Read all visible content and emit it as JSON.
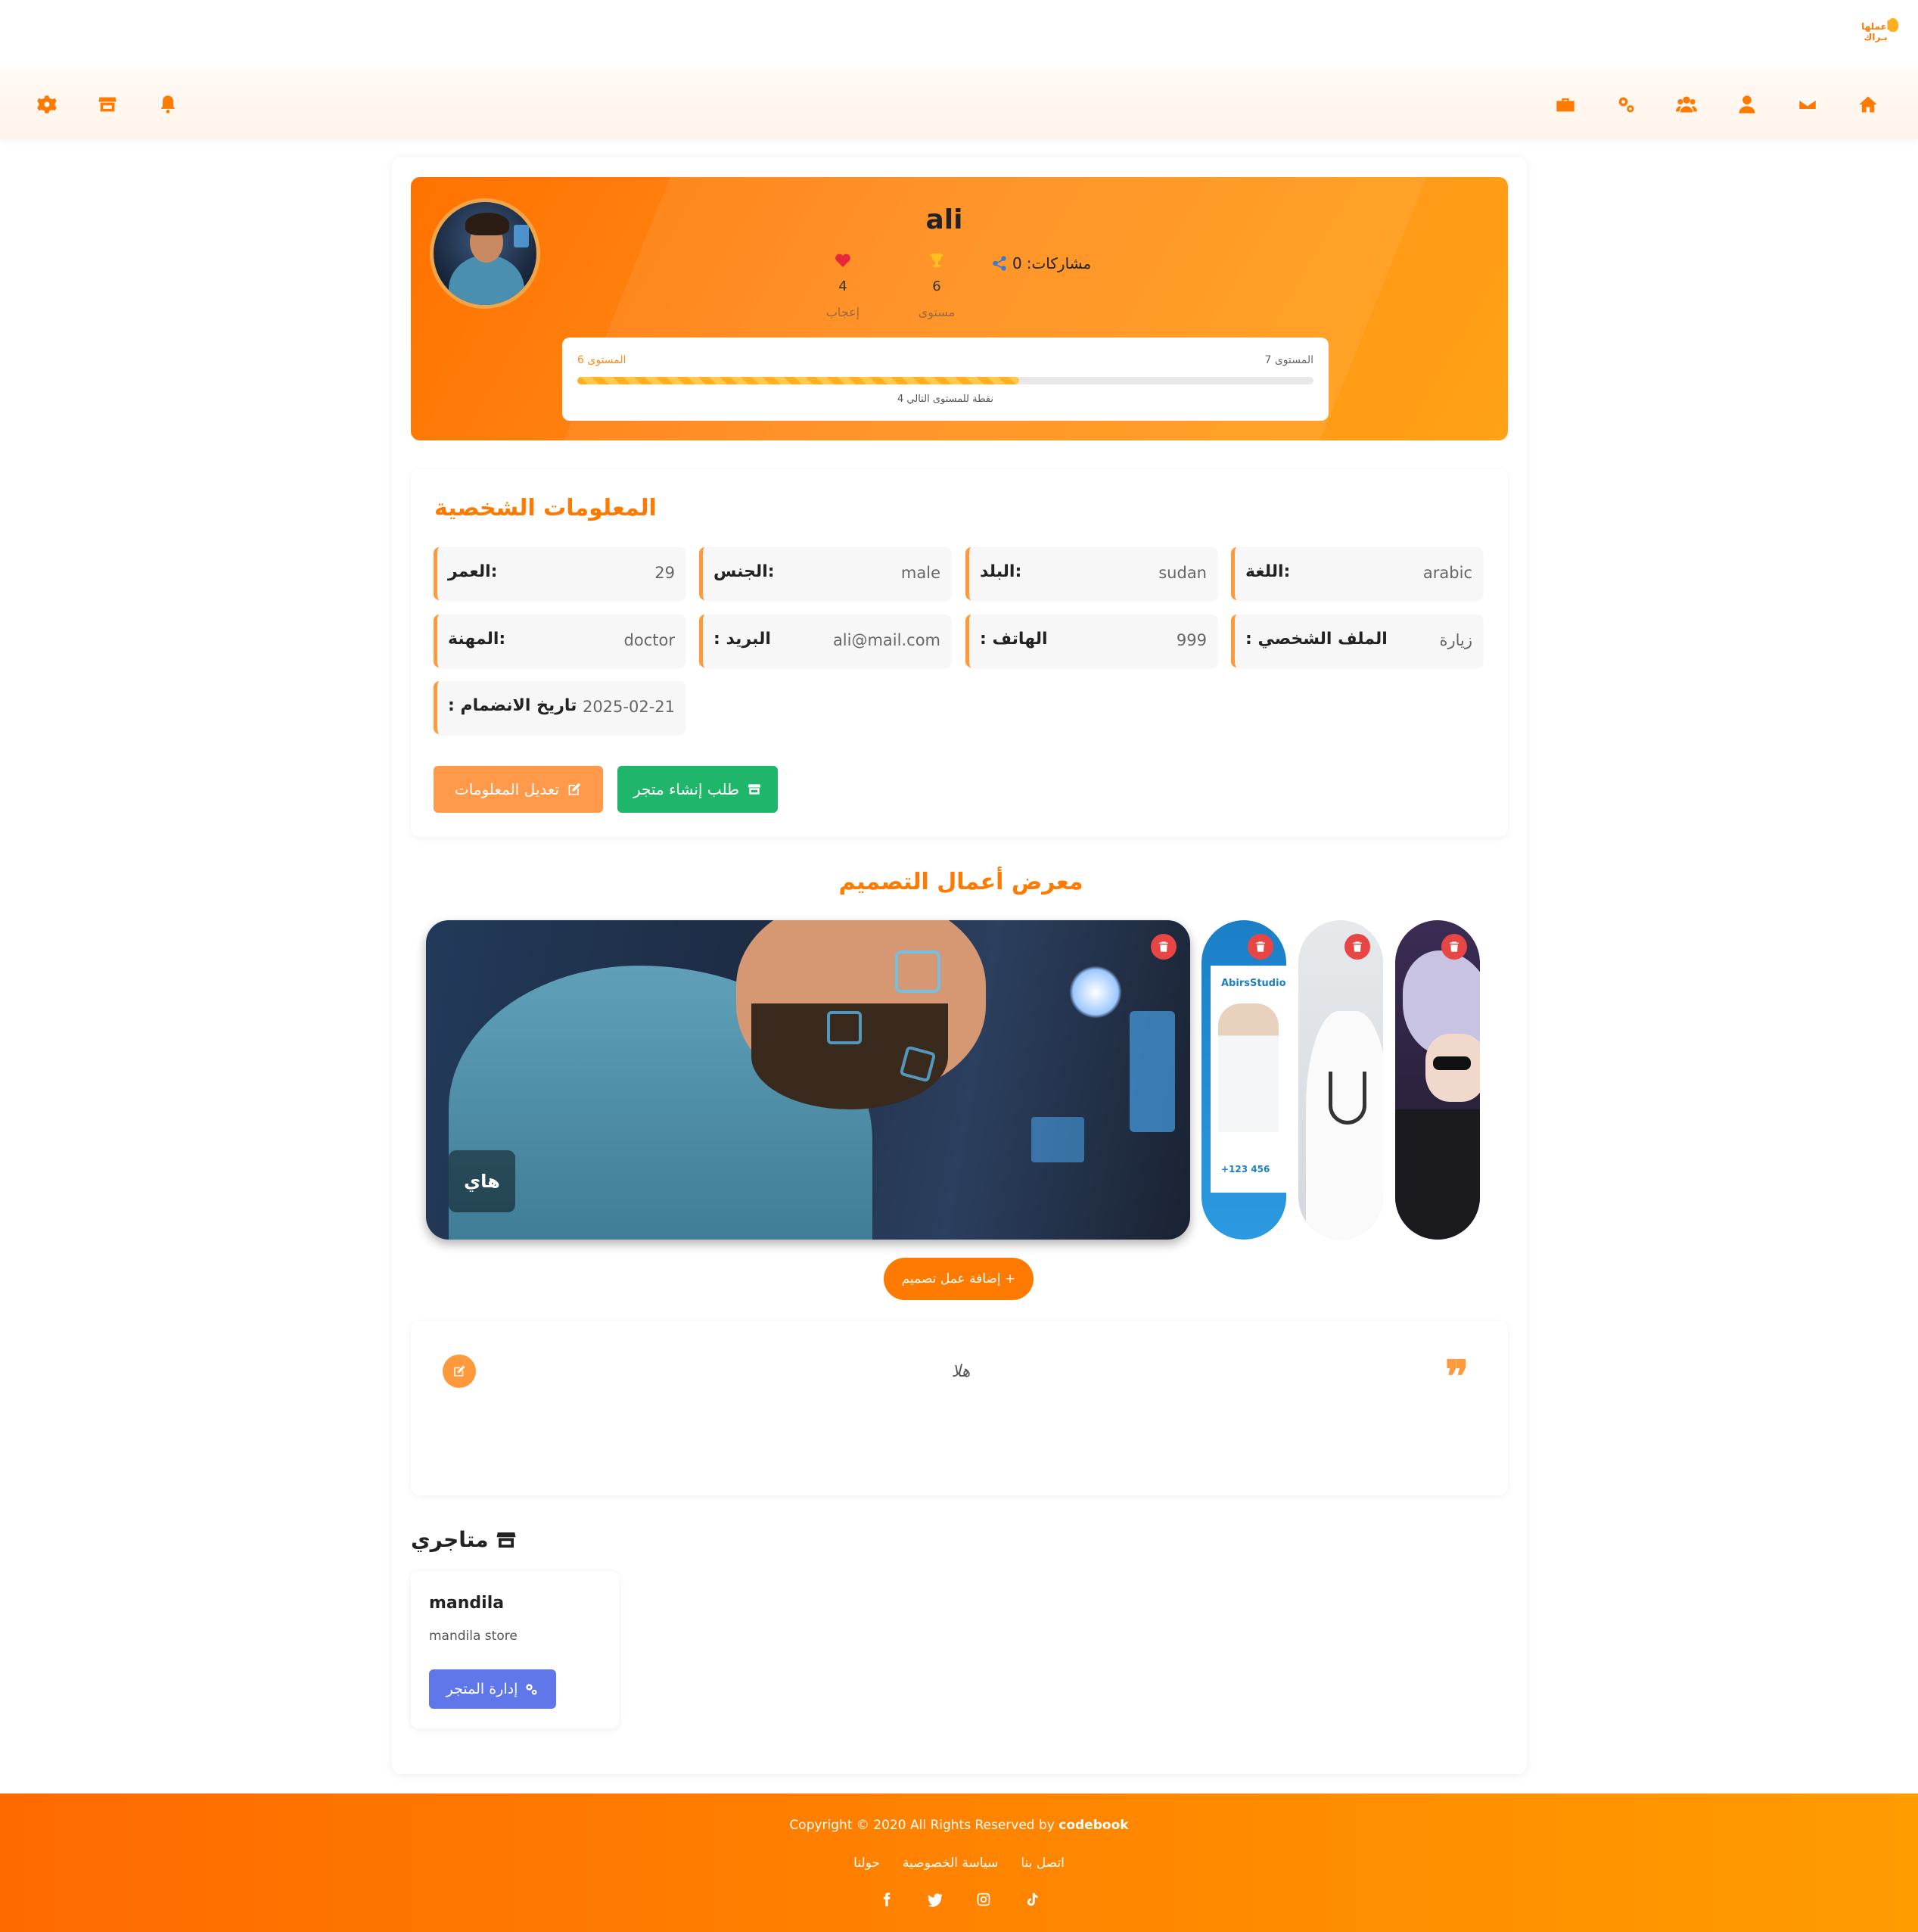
{
  "brand": {
    "logo_text": "أعملها بـراك",
    "accent": "#ff7a00"
  },
  "nav": {
    "right_icons": [
      "home-icon",
      "envelope-icon",
      "user-icon",
      "users-icon",
      "gears-icon",
      "briefcase-icon"
    ],
    "left_icons": [
      "bell-icon",
      "store-icon",
      "gear-icon"
    ]
  },
  "profile": {
    "username": "ali",
    "shares_label": "مشاركات:",
    "shares_value": "0",
    "level_value": "6",
    "level_label": "مستوى",
    "likes_value": "4",
    "likes_label": "إعجاب",
    "progress": {
      "current_level_label": "المستوى 6",
      "next_level_label": "المستوى 7",
      "points_to_next": "نقطة للمستوى التالي 4",
      "fill_fraction": 0.6
    }
  },
  "personal_info": {
    "title": "المعلومات الشخصية",
    "fields": {
      "language_label": "اللغة:",
      "language_value": "arabic",
      "country_label": "البلد:",
      "country_value": "sudan",
      "gender_label": "الجنس:",
      "gender_value": "male",
      "age_label": "العمر:",
      "age_value": "29",
      "profile_label": ": الملف الشخصي",
      "profile_value": "زيارة",
      "phone_label": ": الهاتف",
      "phone_value": "999",
      "email_label": ": البريد",
      "email_value": "ali@mail.com",
      "job_label": "المهنة:",
      "job_value": "doctor",
      "joined_label": ": تاريخ الانضمام",
      "joined_value": "2025-02-21"
    },
    "edit_button": "تعديل المعلومات",
    "store_request_button": "طلب إنشاء متجر"
  },
  "gallery": {
    "title": "معرض أعمال التصميم",
    "main_caption": "هاي",
    "thumb1_brand": "AbirsStudio",
    "thumb1_phone": "+123 456",
    "add_button": "إضافة عمل تصميم +"
  },
  "quote": {
    "text": "هلا",
    "mark": "❞"
  },
  "stores": {
    "title": "متاجري",
    "items": [
      {
        "name": "mandila",
        "description": "mandila store",
        "manage_button": "إدارة المتجر"
      }
    ]
  },
  "footer": {
    "copyright_prefix": "Copyright © 2020 All Rights Reserved by ",
    "copyright_brand": "codebook",
    "links": [
      "اتصل بنا",
      "سياسة الخصوصية",
      "حولنا"
    ],
    "socials": [
      "facebook-icon",
      "twitter-icon",
      "instagram-icon",
      "tiktok-icon"
    ]
  }
}
